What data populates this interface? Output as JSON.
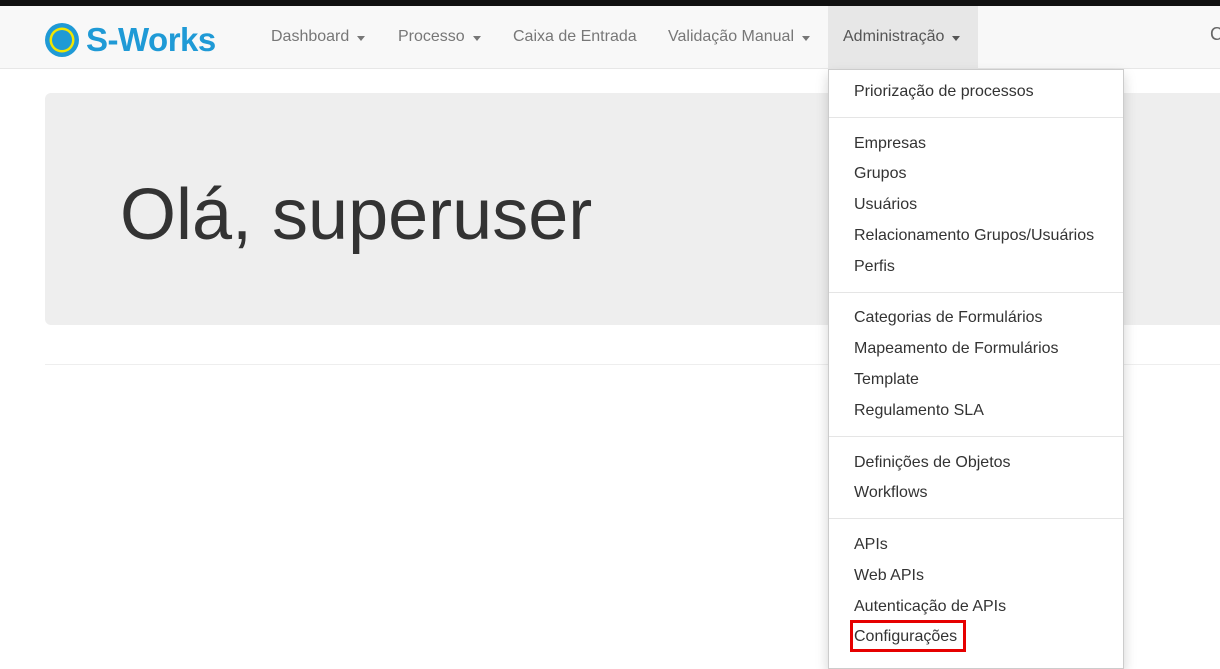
{
  "brand": {
    "name": "S-Works",
    "accent_color": "#1f9ad6"
  },
  "nav": {
    "items": [
      {
        "label": "Dashboard"
      },
      {
        "label": "Processo"
      },
      {
        "label": "Caixa de Entrada"
      },
      {
        "label": "Validação Manual"
      },
      {
        "label": "Administração"
      }
    ],
    "search_glyph": "C"
  },
  "main": {
    "greeting": "Olá, superuser"
  },
  "admin_menu": {
    "items": [
      {
        "label": "Priorização de processos"
      },
      {
        "label": "Empresas"
      },
      {
        "label": "Grupos"
      },
      {
        "label": "Usuários"
      },
      {
        "label": "Relacionamento Grupos/Usuários"
      },
      {
        "label": "Perfis"
      },
      {
        "label": "Categorias de Formulários"
      },
      {
        "label": "Mapeamento de Formulários"
      },
      {
        "label": "Template"
      },
      {
        "label": "Regulamento SLA"
      },
      {
        "label": "Definições de Objetos"
      },
      {
        "label": "Workflows"
      },
      {
        "label": "APIs"
      },
      {
        "label": "Web APIs"
      },
      {
        "label": "Autenticação de APIs"
      },
      {
        "label": "Configurações"
      }
    ],
    "highlighted_item": "Configurações",
    "highlight_color": "#e60000"
  }
}
